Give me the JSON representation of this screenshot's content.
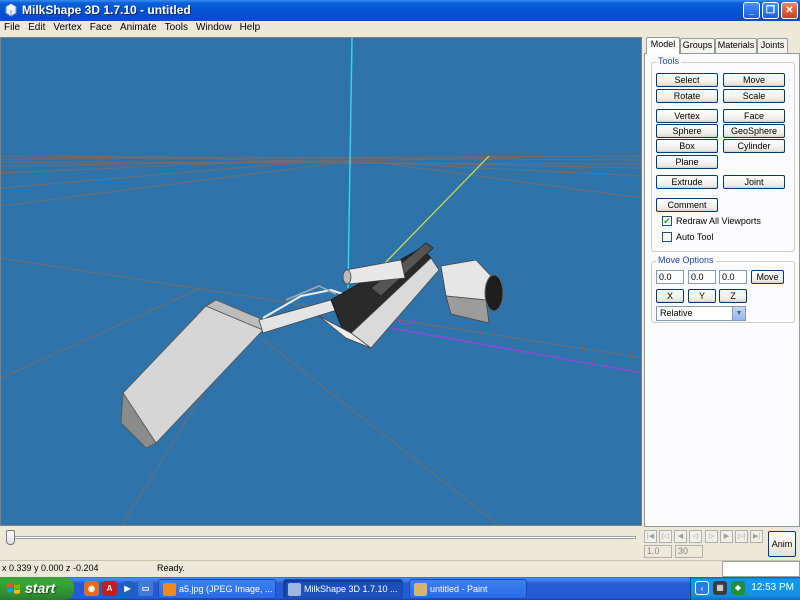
{
  "window": {
    "title": "MilkShape 3D 1.7.10 - untitled",
    "controls": [
      "_",
      "❐",
      "✕"
    ]
  },
  "menubar": {
    "items": [
      "File",
      "Edit",
      "Vertex",
      "Face",
      "Animate",
      "Tools",
      "Window",
      "Help"
    ]
  },
  "panel": {
    "tabs": [
      "Model",
      "Groups",
      "Materials",
      "Joints"
    ],
    "active_tab": "Model",
    "tools": {
      "legend": "Tools",
      "buttons": {
        "select": "Select",
        "move": "Move",
        "rotate": "Rotate",
        "scale": "Scale",
        "vertex": "Vertex",
        "face": "Face",
        "sphere": "Sphere",
        "geosphere": "GeoSphere",
        "box": "Box",
        "cylinder": "Cylinder",
        "plane": "Plane",
        "extrude": "Extrude",
        "joint": "Joint",
        "comment": "Comment"
      },
      "redraw_all": {
        "label": "Redraw All Viewports",
        "checked": true
      },
      "auto_tool": {
        "label": "Auto Tool",
        "checked": false
      }
    },
    "move_options": {
      "legend": "Move Options",
      "x_value": "0.0",
      "y_value": "0.0",
      "z_value": "0.0",
      "move_button": "Move",
      "axis_x": "X",
      "axis_y": "Y",
      "axis_z": "Z",
      "mode": "Relative"
    }
  },
  "timeline": {
    "position": 0,
    "nav_buttons": [
      "|◀",
      "|◁",
      "◀",
      "◁",
      "▷",
      "▶",
      "▷|",
      "▶|"
    ],
    "frame_current": "1.0",
    "frame_total": "30",
    "anim_button": "Anim"
  },
  "statusbar": {
    "coords": "x 0.339 y 0.000 z -0.204",
    "status": "Ready."
  },
  "taskbar": {
    "start": "start",
    "tasks": [
      {
        "label": "a5.jpg (JPEG Image, ...",
        "active": false,
        "color": "#F08A1C"
      },
      {
        "label": "MilkShape 3D 1.7.10 ...",
        "active": true,
        "color": "#9DB7DE"
      },
      {
        "label": "untitled - Paint",
        "active": false,
        "color": "#D9B46A"
      }
    ],
    "clock": "12:53 PM"
  },
  "colors": {
    "viewport_bg": "#2E74AA",
    "axis_y": "#31D6E6",
    "axis_x": "#D8E040",
    "axis_z": "#8C4BD6"
  }
}
